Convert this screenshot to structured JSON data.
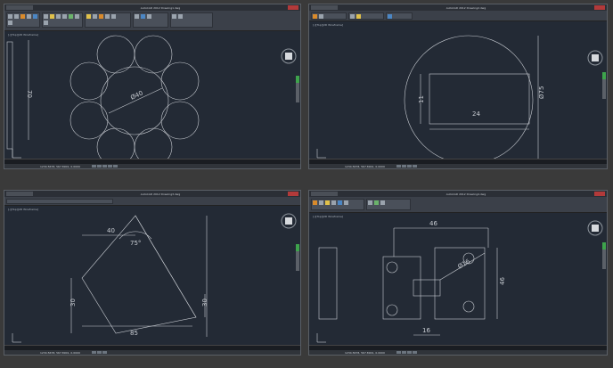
{
  "quadrants": [
    {
      "title": "AutoCAD 2012  Drawing1.dwg",
      "viewport_label": "[-][Top][2D Wireframe]",
      "dims": {
        "outer_dia": "Ø40",
        "height": "70"
      }
    },
    {
      "title": "AutoCAD 2012  Drawing2.dwg",
      "viewport_label": "[-][Top][2D Wireframe]",
      "dims": {
        "rect_w": "24",
        "rect_h": "11",
        "circle_dia": "Ø75"
      }
    },
    {
      "title": "AutoCAD 2012  Drawing3.dwg",
      "viewport_label": "[-][Top][2D Wireframe]",
      "dims": {
        "top_w": "40",
        "angle": "75°",
        "left_h": "30",
        "right_h": "30",
        "bottom_w": "85"
      }
    },
    {
      "title": "AutoCAD 2012  Drawing4.dwg",
      "viewport_label": "[-][Top][2D Wireframe]",
      "dims": {
        "top_w": "46",
        "diag": "Ø16",
        "right_h": "46",
        "bottom_w": "16"
      }
    }
  ],
  "status_coord": "1234.5678, 567.8901, 0.0000",
  "colors": {
    "canvas_bg": "#232a35",
    "line": "#c8ccd2",
    "accent": "#3ea34c"
  }
}
